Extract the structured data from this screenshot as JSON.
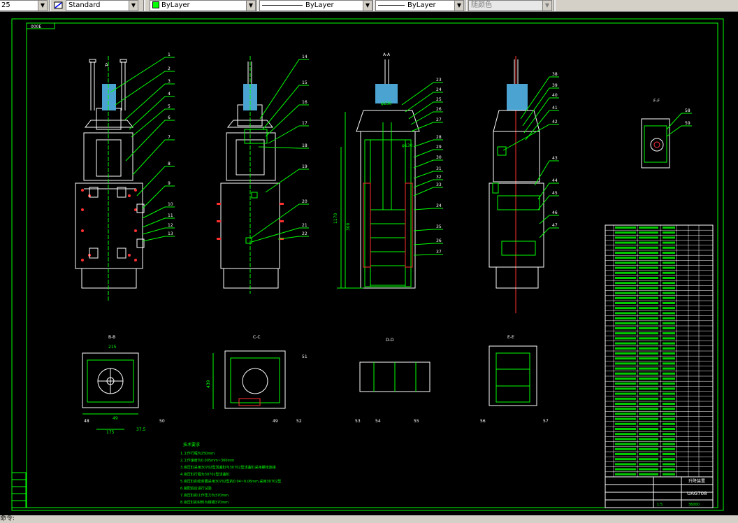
{
  "toolbar": {
    "dimstyle_value": "25",
    "textstyle_value": "Standard",
    "layer_value": "ByLayer",
    "linetype_value": "ByLayer",
    "lineweight_value": "ByLayer",
    "color_value": "随颜色"
  },
  "drawing": {
    "title_tag": "000E",
    "views": {
      "front": "A",
      "section_aa": "A-A",
      "section_ff": "F-F",
      "section_bb": "B-B",
      "section_cc": "C-C",
      "section_dd": "D-D",
      "section_ee": "E-E"
    },
    "balloons": [
      "1",
      "2",
      "3",
      "4",
      "5",
      "6",
      "7",
      "8",
      "9",
      "10",
      "11",
      "12",
      "13",
      "14",
      "15",
      "16",
      "17",
      "18",
      "19",
      "20",
      "21",
      "22",
      "23",
      "24",
      "25",
      "26",
      "27",
      "28",
      "29",
      "30",
      "31",
      "32",
      "33",
      "34",
      "35",
      "36",
      "37",
      "38",
      "39",
      "40",
      "41",
      "42",
      "43",
      "44",
      "45",
      "46",
      "47",
      "48",
      "49",
      "50",
      "51",
      "52",
      "53",
      "54",
      "55",
      "56",
      "57",
      "58",
      "59"
    ],
    "dims": {
      "d1": "215",
      "d2": "175",
      "d3": "370",
      "d4": "49",
      "d5": "37.5",
      "d6": "439",
      "d7": "1170",
      "d8": "300",
      "d9": "φ230",
      "d10": "φ130"
    },
    "notes_title": "技术要求",
    "notes": [
      "1.工作行程为250mm",
      "2.工作速度为0.005mm~360mm",
      "3.液压缸采用30702型活塞缸与30702型活塞缸采用螺栓连接",
      "4.液压缸行程为30702型活塞缸",
      "5.液压缸的密封圈采用30702型的0.04~0.06mm,采用30702型",
      "6.装配后应进行试验",
      "7.液压缸的工作压力为370mm",
      "8.液压缸的材料为铸钢370mm"
    ],
    "title_block": {
      "name": "升降装置",
      "code": "UAG708",
      "scale": "1:5",
      "sheet": "36000"
    }
  },
  "statusbar": {
    "command": "命令:"
  }
}
